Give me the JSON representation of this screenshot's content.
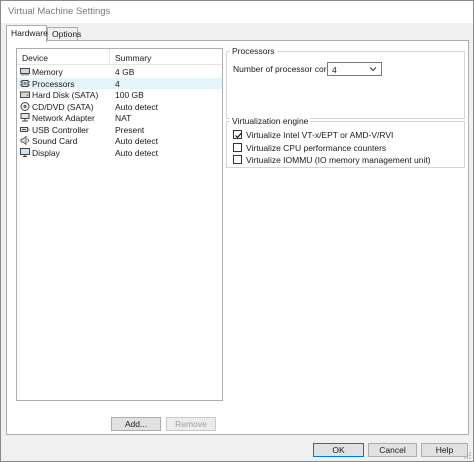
{
  "window": {
    "title": "Virtual Machine Settings"
  },
  "tabs": [
    {
      "label": "Hardware",
      "active": true
    },
    {
      "label": "Options",
      "active": false
    }
  ],
  "device_list": {
    "columns": [
      "Device",
      "Summary"
    ],
    "rows": [
      {
        "icon": "memory-icon",
        "device": "Memory",
        "summary": "4 GB",
        "selected": false
      },
      {
        "icon": "processor-icon",
        "device": "Processors",
        "summary": "4",
        "selected": true
      },
      {
        "icon": "hard-disk-icon",
        "device": "Hard Disk (SATA)",
        "summary": "100 GB",
        "selected": false
      },
      {
        "icon": "cd-dvd-icon",
        "device": "CD/DVD (SATA)",
        "summary": "Auto detect",
        "selected": false
      },
      {
        "icon": "network-adapter-icon",
        "device": "Network Adapter",
        "summary": "NAT",
        "selected": false
      },
      {
        "icon": "usb-icon",
        "device": "USB Controller",
        "summary": "Present",
        "selected": false
      },
      {
        "icon": "sound-card-icon",
        "device": "Sound Card",
        "summary": "Auto detect",
        "selected": false
      },
      {
        "icon": "display-icon",
        "device": "Display",
        "summary": "Auto detect",
        "selected": false
      }
    ]
  },
  "buttons": {
    "add": "Add...",
    "remove": "Remove"
  },
  "processors": {
    "group_label": "Processors",
    "cores_label": "Number of processor cores:",
    "cores_value": "4"
  },
  "virtualization": {
    "group_label": "Virtualization engine",
    "options": [
      {
        "label": "Virtualize Intel VT-x/EPT or AMD-V/RVI",
        "checked": true
      },
      {
        "label": "Virtualize CPU performance counters",
        "checked": false
      },
      {
        "label": "Virtualize IOMMU (IO memory management unit)",
        "checked": false
      }
    ]
  },
  "dialog_buttons": {
    "ok": "OK",
    "cancel": "Cancel",
    "help": "Help"
  },
  "colors": {
    "selection": "#e5f3fb",
    "accent": "#0078d7"
  }
}
